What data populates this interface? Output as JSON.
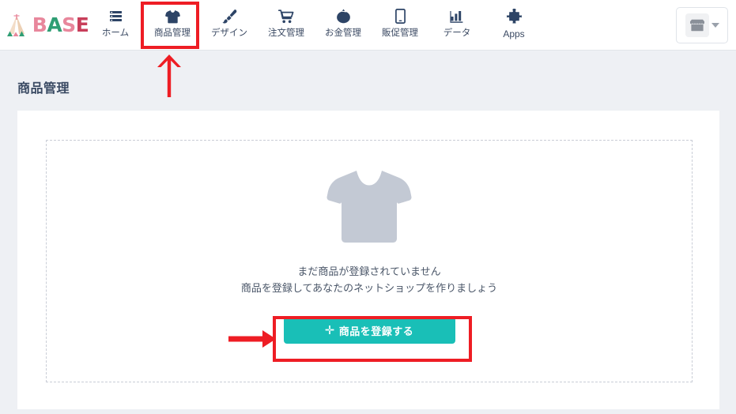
{
  "header": {
    "logo": {
      "name": "base-logo",
      "wordmark": [
        {
          "char": "B",
          "color": "#e8879c"
        },
        {
          "char": "A",
          "color": "#2f9e74"
        },
        {
          "char": "S",
          "color": "#e8879c"
        },
        {
          "char": "E",
          "color": "#c83e5a"
        }
      ],
      "mark_icon": "tent-icon"
    },
    "nav_items": [
      {
        "label": "ホーム",
        "icon": "list-menu-icon",
        "latin": false,
        "active": false
      },
      {
        "label": "商品管理",
        "icon": "tshirt-icon",
        "latin": false,
        "active": true
      },
      {
        "label": "デザイン",
        "icon": "paintbrush-icon",
        "latin": false,
        "active": false
      },
      {
        "label": "注文管理",
        "icon": "shopping-cart-icon",
        "latin": false,
        "active": false
      },
      {
        "label": "お金管理",
        "icon": "coin-purse-icon",
        "latin": false,
        "active": false
      },
      {
        "label": "販促管理",
        "icon": "mobile-phone-icon",
        "latin": false,
        "active": false
      },
      {
        "label": "データ",
        "icon": "bar-chart-icon",
        "latin": false,
        "active": false
      },
      {
        "label": "Apps",
        "icon": "puzzle-piece-icon",
        "latin": true,
        "active": false
      }
    ],
    "shop_switcher": {
      "icon": "storefront-icon",
      "chevron": "chevron-down-icon"
    }
  },
  "page": {
    "title": "商品管理"
  },
  "main": {
    "illustration": "tshirt-placeholder-icon",
    "empty_line1": "まだ商品が登録されていません",
    "empty_line2": "商品を登録してあなたのネットショップを作りましょう",
    "cta": {
      "plus": "✛",
      "label": "商品を登録する"
    }
  },
  "annotations": {
    "highlight_color": "#ee1d24",
    "nav_highlight_target": "商品管理",
    "cta_highlight_target": "商品を登録する",
    "arrow_up": "arrow-up-annotation",
    "arrow_right": "arrow-right-annotation"
  },
  "colors": {
    "accent_teal": "#19bfb7",
    "page_bg": "#eef0f4",
    "card_bg": "#ffffff",
    "text_dark": "#3a4a63",
    "annotation_red": "#ee1d24"
  }
}
